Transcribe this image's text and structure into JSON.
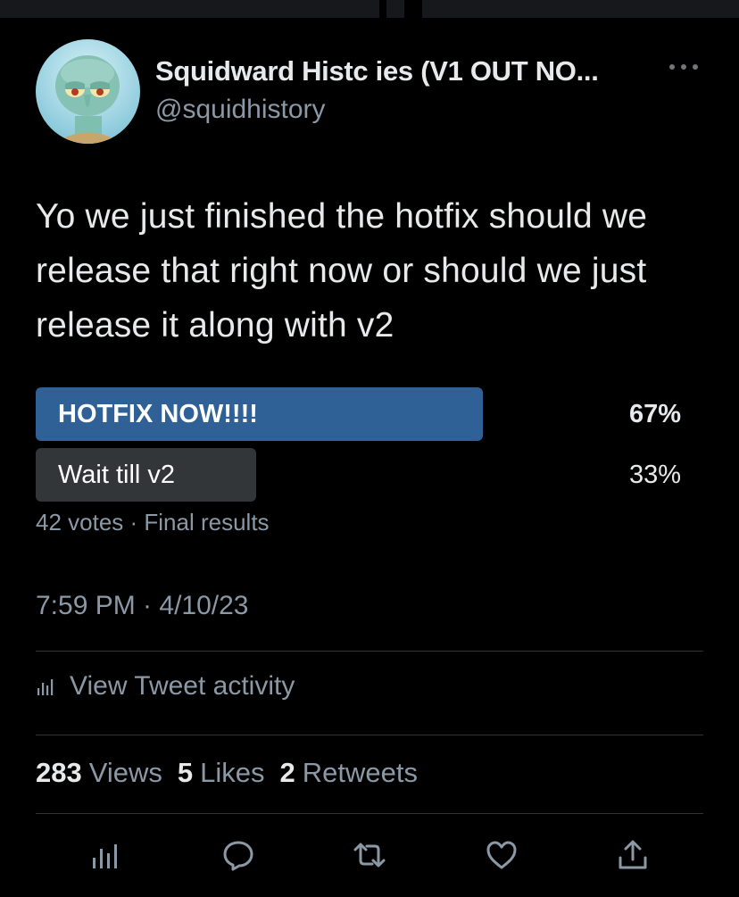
{
  "tweet": {
    "display_name": "Squidward Histc ies (V1 OUT NO...",
    "handle": "@squidhistory",
    "text": "Yo we just finished the hotfix should we release that right now or should we just release it along with v2",
    "timestamp": "7:59 PM · 4/10/23"
  },
  "poll": {
    "options": [
      {
        "label": "HOTFIX NOW!!!!",
        "percent_text": "67%",
        "fraction": 0.67,
        "color": "#2f6096",
        "winner": true
      },
      {
        "label": "Wait till v2",
        "percent_text": "33%",
        "fraction": 0.33,
        "color": "#333639",
        "winner": false
      }
    ],
    "meta": "42 votes · Final results"
  },
  "activity": {
    "label": "View Tweet activity",
    "icon": "analytics-icon"
  },
  "stats": [
    {
      "count": "283",
      "label": "Views"
    },
    {
      "count": "5",
      "label": "Likes"
    },
    {
      "count": "2",
      "label": "Retweets"
    }
  ],
  "actions": [
    {
      "icon": "analytics-icon"
    },
    {
      "icon": "reply-icon"
    },
    {
      "icon": "retweet-icon"
    },
    {
      "icon": "like-icon"
    },
    {
      "icon": "share-icon"
    }
  ],
  "colors": {
    "background": "#000000",
    "text_primary": "#e7e9ea",
    "text_secondary": "#8b98a5",
    "divider": "#2f3336",
    "poll_winner": "#2f6096",
    "poll_other": "#333639"
  }
}
